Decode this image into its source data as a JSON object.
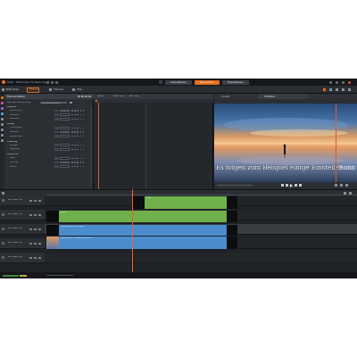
{
  "app": {
    "menu": [
      "Datei",
      "Bearbeiten",
      "Einstellungen"
    ],
    "tabs": [
      {
        "label": "Importieren",
        "active": false
      },
      {
        "label": "Bearbeiten",
        "active": true
      },
      {
        "label": "Exportieren",
        "active": false
      }
    ],
    "accent": "#e8701c"
  },
  "toolbar": {
    "items": [
      "Bibliothek",
      "Effekte",
      "Themen",
      "Titel"
    ]
  },
  "effects": {
    "title": "Eigenschaften",
    "preset_label": "Standardeinstellung",
    "preset_value": "Benutzerdefiniert",
    "sections": [
      {
        "name": "Position",
        "rows": [
          "Horizontal",
          "Vertikal",
          "Rotation"
        ]
      },
      {
        "name": "Größe",
        "rows": [
          "Horizontal",
          "Vertikal",
          "Seitenverh."
        ]
      },
      {
        "name": "Drehung",
        "rows": [
          "Winkel",
          "Neigung"
        ]
      },
      {
        "name": "Deckkraft",
        "rows": [
          "Wert",
          "Blende",
          "Kante"
        ]
      }
    ]
  },
  "keyframes": {
    "tabs": [
      "Name",
      "Alle Clips",
      "Nur Zeit"
    ]
  },
  "preview": {
    "tabs": [
      {
        "label": "Quelle",
        "active": false
      },
      {
        "label": "Timeline",
        "active": true
      }
    ],
    "caption": "Es folgen zum Beispiel einige Einsteller",
    "caption_right": "Sonn"
  },
  "timeline": {
    "tracks": [
      {
        "name": "A/V Spur (4)"
      },
      {
        "name": "A/V Spur (3)"
      },
      {
        "name": "A/V Spur (2)"
      },
      {
        "name": "A/V Spur (1)"
      },
      {
        "name": "A/V Spur (0)"
      }
    ],
    "clips": [
      {
        "label": "Titel",
        "track": 0,
        "color": "#6eb04a"
      },
      {
        "label": "Audio",
        "track": 1,
        "color": "#6eb04a"
      },
      {
        "label": "Audio-Loop Mehrspur",
        "track": 2,
        "color": "#4a8ccc"
      },
      {
        "label": "Audio-Loop Hintergrund MP3",
        "track": 3,
        "color": "#4a8ccc"
      }
    ]
  }
}
